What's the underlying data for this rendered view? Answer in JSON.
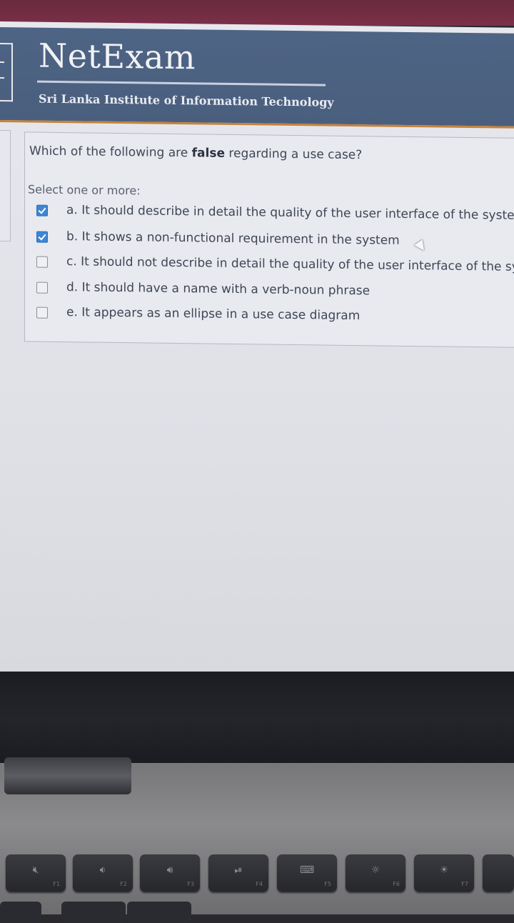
{
  "brand": {
    "title": "NetExam",
    "subtitle": "Sri Lanka Institute of Information Technology"
  },
  "question": {
    "text_before": "Which of the following are ",
    "text_bold": "false",
    "text_after": " regarding a use case?",
    "select_label": "Select one or more:",
    "options": [
      {
        "label": "a. It should describe in detail the quality of the user interface of the system",
        "checked": true
      },
      {
        "label": "b. It shows a non-functional requirement in the system",
        "checked": true
      },
      {
        "label": "c. It should not describe in detail the quality of the user interface of the system",
        "checked": false
      },
      {
        "label": "d. It should have a name with a verb-noun phrase",
        "checked": false
      },
      {
        "label": "e. It appears as an ellipse in a use case diagram",
        "checked": false
      }
    ]
  },
  "keyboard": {
    "keys": [
      {
        "icon": "mute-icon",
        "glyph": "🔇︎",
        "fn": "F1"
      },
      {
        "icon": "volume-down-icon",
        "glyph": "🔉︎",
        "fn": "F2"
      },
      {
        "icon": "volume-up-icon",
        "glyph": "🔊︎",
        "fn": "F3"
      },
      {
        "icon": "play-pause-icon",
        "glyph": "⏯︎",
        "fn": "F4"
      },
      {
        "icon": "keyboard-backlight-icon",
        "glyph": "⌨︎",
        "fn": "F5"
      },
      {
        "icon": "brightness-down-icon",
        "glyph": "☼",
        "fn": "F6"
      },
      {
        "icon": "brightness-up-icon",
        "glyph": "☀︎",
        "fn": "F7"
      }
    ]
  },
  "colors": {
    "header": "#4e6484",
    "accent": "#c7823a",
    "checkbox_checked": "#3c86d3"
  }
}
